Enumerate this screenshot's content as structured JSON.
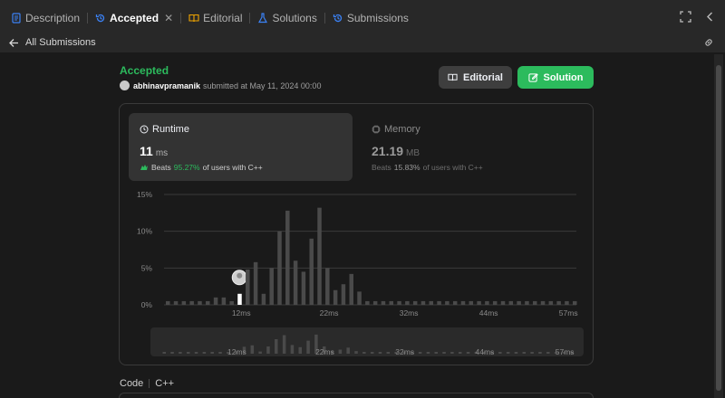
{
  "tabs": [
    {
      "label": "Description",
      "icon": "description-icon"
    },
    {
      "label": "Accepted",
      "icon": "history-icon",
      "active": true
    },
    {
      "label": "Editorial",
      "icon": "book-icon"
    },
    {
      "label": "Solutions",
      "icon": "flask-icon"
    },
    {
      "label": "Submissions",
      "icon": "history-icon"
    }
  ],
  "subbar": {
    "back_label": "All Submissions"
  },
  "submission": {
    "status": "Accepted",
    "username": "abhinavpramanik",
    "submitted_text": "submitted at May 11, 2024 00:00"
  },
  "buttons": {
    "editorial": "Editorial",
    "solution": "Solution"
  },
  "runtime": {
    "title": "Runtime",
    "value": "11",
    "unit": "ms",
    "beats_prefix": "Beats",
    "beats_pct": "95.27%",
    "beats_suffix": "of users with C++"
  },
  "memory": {
    "title": "Memory",
    "value": "21.19",
    "unit": "MB",
    "beats_prefix": "Beats",
    "beats_pct": "15.83%",
    "beats_suffix": "of users with C++"
  },
  "code": {
    "label": "Code",
    "language": "C++"
  },
  "colors": {
    "accent_green": "#2cbb5d",
    "bar": "#4a4a4a",
    "highlight_bar": "#ffffff"
  },
  "chart_data": {
    "type": "bar",
    "title": "",
    "xlabel": "",
    "ylabel": "",
    "ylim": [
      0,
      15
    ],
    "yticks": [
      "15%",
      "10%",
      "5%",
      "0%"
    ],
    "ytick_values": [
      15,
      10,
      5,
      0
    ],
    "xticks": [
      "12ms",
      "22ms",
      "32ms",
      "44ms",
      "57ms"
    ],
    "xtick_index": [
      9,
      20,
      30,
      40,
      50
    ],
    "highlight_index": 9,
    "highlight_label": "11 ms",
    "values": [
      0.5,
      0.5,
      0.5,
      0.5,
      0.5,
      0.5,
      1.0,
      1.0,
      0.5,
      1.5,
      4.8,
      5.8,
      1.5,
      5.0,
      10.0,
      12.8,
      6.0,
      4.5,
      9.0,
      13.2,
      5.0,
      2.0,
      2.8,
      4.2,
      1.8,
      0.5,
      0.5,
      0.5,
      0.5,
      0.5,
      0.5,
      0.5,
      0.5,
      0.5,
      0.5,
      0.5,
      0.5,
      0.5,
      0.5,
      0.5,
      0.5,
      0.5,
      0.5,
      0.5,
      0.5,
      0.5,
      0.5,
      0.5,
      0.5,
      0.5,
      0.5,
      0.5
    ]
  }
}
